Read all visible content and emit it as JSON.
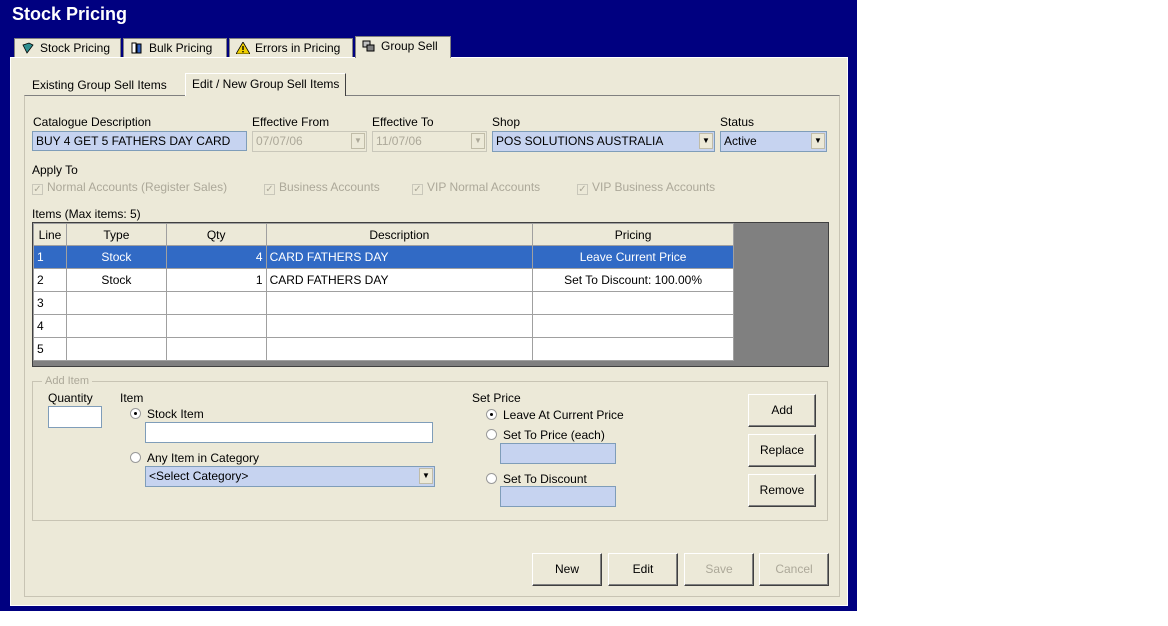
{
  "window": {
    "title": "Stock Pricing"
  },
  "tabs": [
    {
      "label": "Stock Pricing",
      "icon": "book-icon"
    },
    {
      "label": "Bulk Pricing",
      "icon": "books-icon"
    },
    {
      "label": "Errors in Pricing",
      "icon": "warning-icon"
    },
    {
      "label": "Group Sell",
      "icon": "group-icon"
    }
  ],
  "subtabs": [
    "Existing Group Sell Items",
    "Edit / New Group Sell Items"
  ],
  "form": {
    "catalogue_label": "Catalogue Description",
    "catalogue_value": "BUY 4 GET 5 FATHERS DAY CARD",
    "effective_from_label": "Effective From",
    "effective_from_value": "07/07/06",
    "effective_to_label": "Effective To",
    "effective_to_value": "11/07/06",
    "shop_label": "Shop",
    "shop_value": "POS SOLUTIONS AUSTRALIA",
    "status_label": "Status",
    "status_value": "Active",
    "apply_to_label": "Apply To",
    "apply_to": [
      "Normal Accounts (Register Sales)",
      "Business Accounts",
      "VIP Normal Accounts",
      "VIP Business Accounts"
    ]
  },
  "items": {
    "label": "Items (Max items: 5)",
    "columns": [
      "Line",
      "Type",
      "Qty",
      "Description",
      "Pricing"
    ],
    "rows": [
      {
        "line": "1",
        "type": "Stock",
        "qty": "4",
        "description": "CARD FATHERS DAY",
        "pricing": "Leave Current Price"
      },
      {
        "line": "2",
        "type": "Stock",
        "qty": "1",
        "description": "CARD FATHERS DAY",
        "pricing": "Set To Discount: 100.00%"
      },
      {
        "line": "3",
        "type": "",
        "qty": "",
        "description": "",
        "pricing": ""
      },
      {
        "line": "4",
        "type": "",
        "qty": "",
        "description": "",
        "pricing": ""
      },
      {
        "line": "5",
        "type": "",
        "qty": "",
        "description": "",
        "pricing": ""
      }
    ]
  },
  "add_item": {
    "title": "Add Item",
    "quantity_label": "Quantity",
    "item_label": "Item",
    "stock_item_label": "Stock Item",
    "any_item_label": "Any Item in Category",
    "category_value": "<Select Category>",
    "set_price_label": "Set Price",
    "leave_label": "Leave At Current Price",
    "set_price_each_label": "Set To Price (each)",
    "set_discount_label": "Set To Discount",
    "add_button": "Add",
    "replace_button": "Replace",
    "remove_button": "Remove"
  },
  "footer": {
    "new": "New",
    "edit": "Edit",
    "save": "Save",
    "cancel": "Cancel"
  }
}
